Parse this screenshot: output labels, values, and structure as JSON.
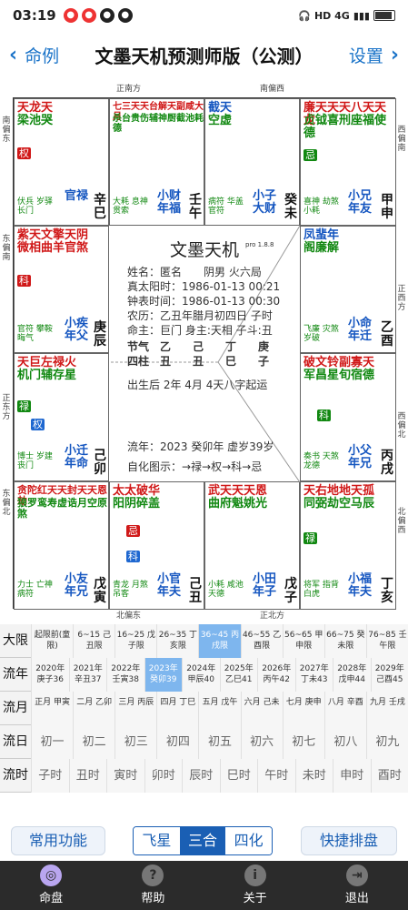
{
  "status": {
    "time": "03:19",
    "network": "HD 4G",
    "battery": ""
  },
  "nav": {
    "back_label": "命例",
    "title": "文墨天机预测师版（公测）",
    "settings_label": "设置"
  },
  "directions": {
    "top_left": "正南方",
    "top_right": "南偏西",
    "left_top": "南偏东",
    "right_top": "西偏南",
    "left_mid": "东偏南",
    "right_mid": "正西方",
    "left_low": "正东方",
    "right_low": "西偏北",
    "left_bottom": "东偏北",
    "right_bottom": "北偏西",
    "bottom_left": "北偏东",
    "bottom_right": "正北方"
  },
  "palaces": [
    {
      "stars": "天龙天",
      "stars2": "梁池哭",
      "palace": "官禄",
      "gz": "辛巳",
      "age": "伏兵 岁驿 长门"
    },
    {
      "stars": "七三天天台解天副咸大月",
      "stars2": "杀台贵伤辅神厨截池耗德",
      "palace": "小财 年福",
      "gz": "壬午",
      "age": "大耗 息神 贯索"
    },
    {
      "stars": "截天",
      "stars2": "空虚",
      "palace": "小子 大财",
      "gz": "癸未",
      "age": "病符 华盖 官符"
    },
    {
      "stars": "廉天天天八天天龙",
      "stars2": "贞钺喜刑座福使德",
      "palace": "小兄 年友",
      "gz": "甲申",
      "age": "喜神 劫煞 小耗"
    },
    {
      "stars": "紫天文擎天阴",
      "stars2": "微相曲羊官煞",
      "palace": "小疾 年父",
      "gz": "庚辰",
      "age": "官符 攀鞍 晦气"
    },
    {
      "stars": "凤蜚年",
      "stars2": "阁廉解",
      "palace": "小命 年迁",
      "gz": "乙酉",
      "age": "飞廉 灾煞 岁破"
    },
    {
      "stars": "天巨左禄火",
      "stars2": "机门辅存星",
      "palace": "小迁 年命",
      "gz": "己卯",
      "age": "博士 岁建 丧门"
    },
    {
      "stars": "破文铃副寡天",
      "stars2": "军昌星旬宿德",
      "palace": "小父 年兄",
      "gz": "丙戌",
      "age": "奏书 天煞 龙德"
    },
    {
      "stars": "贪陀红天天封天天恩劫",
      "stars2": "狼罗鸾寿虚诰月空原煞",
      "palace": "小友 年兄",
      "gz": "戊寅",
      "age": "力士 亡神 病符"
    },
    {
      "stars": "太太破华",
      "stars2": "阳阴碎盖",
      "palace": "小官 年夫",
      "gz": "己丑",
      "age": "青龙 月煞 吊客"
    },
    {
      "stars": "武天天天恩",
      "stars2": "曲府魁姚光",
      "palace": "小田 年子",
      "gz": "戊子",
      "age": "小耗 咸池 天德"
    },
    {
      "stars": "天右地地天孤",
      "stars2": "同弼劫空马辰",
      "palace": "小福 年夫",
      "gz": "丁亥",
      "age": "将军 指背 白虎"
    }
  ],
  "center": {
    "brand": "文墨天机",
    "version": "pro 1.8.8",
    "name": "姓名：匿名　　阴男 火六局",
    "true_solar": "真太阳时：1986-01-13 00:21",
    "clock": "钟表时间：1986-01-13 00:30",
    "lunar": "农历：乙丑年腊月初四日 子时",
    "master": "命主：巨门 身主:天相 子斗:丑",
    "jieqi": "节气　乙　　己　　丁　　庚",
    "sizhu": "四柱　丑　　丑　　巳　　子",
    "start_luck": "出生后 2年 4月 4天八字起运",
    "flow_year": "流年：2023 癸卯年 虚岁39岁",
    "legend": "自化图示：→禄→权→科→忌"
  },
  "rows": {
    "daxian_label": "大限",
    "daxian": [
      "起限前(童限)",
      "6~15 己丑限",
      "16~25 戊子限",
      "26~35 丁亥限",
      "36~45 丙戌限",
      "46~55 乙酉限",
      "56~65 甲申限",
      "66~75 癸未限",
      "76~85 壬午限"
    ],
    "liunian_label": "流年",
    "liunian": [
      "2020年 庚子36",
      "2021年 辛丑37",
      "2022年 壬寅38",
      "2023年 癸卯39",
      "2024年 甲辰40",
      "2025年 乙巳41",
      "2026年 丙午42",
      "2027年 丁未43",
      "2028年 戊申44",
      "2029年 己酉45"
    ],
    "liuyue_label": "流月",
    "liuyue": [
      "正月 甲寅",
      "二月 乙卯",
      "三月 丙辰",
      "四月 丁巳",
      "五月 戊午",
      "六月 己未",
      "七月 庚申",
      "八月 辛酉",
      "九月 壬戌"
    ],
    "liuri_label": "流日",
    "liuri": [
      "初一",
      "初二",
      "初三",
      "初四",
      "初五",
      "初六",
      "初七",
      "初八",
      "初九"
    ],
    "liushi_label": "流时",
    "liushi": [
      "子时",
      "丑时",
      "寅时",
      "卯时",
      "辰时",
      "巳时",
      "午时",
      "未时",
      "申时",
      "酉时"
    ]
  },
  "tools": {
    "common": "常用功能",
    "seg": [
      "飞星",
      "三合",
      "四化"
    ],
    "quick": "快捷排盘"
  },
  "tabs": [
    "命盘",
    "帮助",
    "关于",
    "退出"
  ]
}
